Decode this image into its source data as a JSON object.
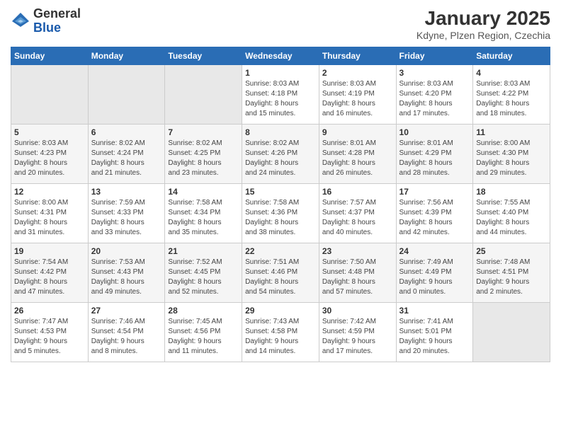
{
  "logo": {
    "general": "General",
    "blue": "Blue"
  },
  "header": {
    "title": "January 2025",
    "subtitle": "Kdyne, Plzen Region, Czechia"
  },
  "weekdays": [
    "Sunday",
    "Monday",
    "Tuesday",
    "Wednesday",
    "Thursday",
    "Friday",
    "Saturday"
  ],
  "weeks": [
    [
      {
        "day": "",
        "info": ""
      },
      {
        "day": "",
        "info": ""
      },
      {
        "day": "",
        "info": ""
      },
      {
        "day": "1",
        "info": "Sunrise: 8:03 AM\nSunset: 4:18 PM\nDaylight: 8 hours\nand 15 minutes."
      },
      {
        "day": "2",
        "info": "Sunrise: 8:03 AM\nSunset: 4:19 PM\nDaylight: 8 hours\nand 16 minutes."
      },
      {
        "day": "3",
        "info": "Sunrise: 8:03 AM\nSunset: 4:20 PM\nDaylight: 8 hours\nand 17 minutes."
      },
      {
        "day": "4",
        "info": "Sunrise: 8:03 AM\nSunset: 4:22 PM\nDaylight: 8 hours\nand 18 minutes."
      }
    ],
    [
      {
        "day": "5",
        "info": "Sunrise: 8:03 AM\nSunset: 4:23 PM\nDaylight: 8 hours\nand 20 minutes."
      },
      {
        "day": "6",
        "info": "Sunrise: 8:02 AM\nSunset: 4:24 PM\nDaylight: 8 hours\nand 21 minutes."
      },
      {
        "day": "7",
        "info": "Sunrise: 8:02 AM\nSunset: 4:25 PM\nDaylight: 8 hours\nand 23 minutes."
      },
      {
        "day": "8",
        "info": "Sunrise: 8:02 AM\nSunset: 4:26 PM\nDaylight: 8 hours\nand 24 minutes."
      },
      {
        "day": "9",
        "info": "Sunrise: 8:01 AM\nSunset: 4:28 PM\nDaylight: 8 hours\nand 26 minutes."
      },
      {
        "day": "10",
        "info": "Sunrise: 8:01 AM\nSunset: 4:29 PM\nDaylight: 8 hours\nand 28 minutes."
      },
      {
        "day": "11",
        "info": "Sunrise: 8:00 AM\nSunset: 4:30 PM\nDaylight: 8 hours\nand 29 minutes."
      }
    ],
    [
      {
        "day": "12",
        "info": "Sunrise: 8:00 AM\nSunset: 4:31 PM\nDaylight: 8 hours\nand 31 minutes."
      },
      {
        "day": "13",
        "info": "Sunrise: 7:59 AM\nSunset: 4:33 PM\nDaylight: 8 hours\nand 33 minutes."
      },
      {
        "day": "14",
        "info": "Sunrise: 7:58 AM\nSunset: 4:34 PM\nDaylight: 8 hours\nand 35 minutes."
      },
      {
        "day": "15",
        "info": "Sunrise: 7:58 AM\nSunset: 4:36 PM\nDaylight: 8 hours\nand 38 minutes."
      },
      {
        "day": "16",
        "info": "Sunrise: 7:57 AM\nSunset: 4:37 PM\nDaylight: 8 hours\nand 40 minutes."
      },
      {
        "day": "17",
        "info": "Sunrise: 7:56 AM\nSunset: 4:39 PM\nDaylight: 8 hours\nand 42 minutes."
      },
      {
        "day": "18",
        "info": "Sunrise: 7:55 AM\nSunset: 4:40 PM\nDaylight: 8 hours\nand 44 minutes."
      }
    ],
    [
      {
        "day": "19",
        "info": "Sunrise: 7:54 AM\nSunset: 4:42 PM\nDaylight: 8 hours\nand 47 minutes."
      },
      {
        "day": "20",
        "info": "Sunrise: 7:53 AM\nSunset: 4:43 PM\nDaylight: 8 hours\nand 49 minutes."
      },
      {
        "day": "21",
        "info": "Sunrise: 7:52 AM\nSunset: 4:45 PM\nDaylight: 8 hours\nand 52 minutes."
      },
      {
        "day": "22",
        "info": "Sunrise: 7:51 AM\nSunset: 4:46 PM\nDaylight: 8 hours\nand 54 minutes."
      },
      {
        "day": "23",
        "info": "Sunrise: 7:50 AM\nSunset: 4:48 PM\nDaylight: 8 hours\nand 57 minutes."
      },
      {
        "day": "24",
        "info": "Sunrise: 7:49 AM\nSunset: 4:49 PM\nDaylight: 9 hours\nand 0 minutes."
      },
      {
        "day": "25",
        "info": "Sunrise: 7:48 AM\nSunset: 4:51 PM\nDaylight: 9 hours\nand 2 minutes."
      }
    ],
    [
      {
        "day": "26",
        "info": "Sunrise: 7:47 AM\nSunset: 4:53 PM\nDaylight: 9 hours\nand 5 minutes."
      },
      {
        "day": "27",
        "info": "Sunrise: 7:46 AM\nSunset: 4:54 PM\nDaylight: 9 hours\nand 8 minutes."
      },
      {
        "day": "28",
        "info": "Sunrise: 7:45 AM\nSunset: 4:56 PM\nDaylight: 9 hours\nand 11 minutes."
      },
      {
        "day": "29",
        "info": "Sunrise: 7:43 AM\nSunset: 4:58 PM\nDaylight: 9 hours\nand 14 minutes."
      },
      {
        "day": "30",
        "info": "Sunrise: 7:42 AM\nSunset: 4:59 PM\nDaylight: 9 hours\nand 17 minutes."
      },
      {
        "day": "31",
        "info": "Sunrise: 7:41 AM\nSunset: 5:01 PM\nDaylight: 9 hours\nand 20 minutes."
      },
      {
        "day": "",
        "info": ""
      }
    ]
  ]
}
